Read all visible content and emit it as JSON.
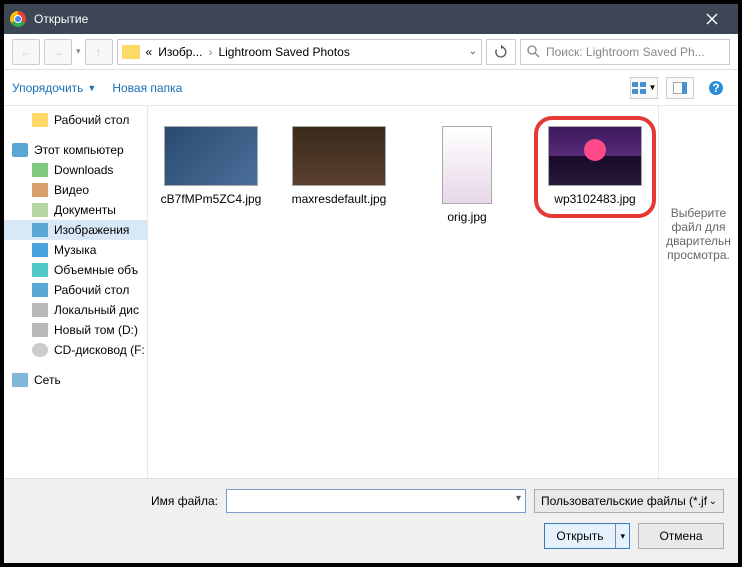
{
  "titlebar": {
    "title": "Открытие"
  },
  "breadcrumb": {
    "prev": "«",
    "p1": "Изобр...",
    "p2": "Lightroom Saved Photos"
  },
  "search": {
    "placeholder": "Поиск: Lightroom Saved Ph..."
  },
  "toolbar": {
    "organize": "Упорядочить",
    "newfolder": "Новая папка"
  },
  "tree": {
    "desktop": "Рабочий стол",
    "thispc": "Этот компьютер",
    "downloads": "Downloads",
    "video": "Видео",
    "documents": "Документы",
    "images": "Изображения",
    "music": "Музыка",
    "objects3d": "Объемные объ",
    "desktop2": "Рабочий стол",
    "localdisk": "Локальный дис",
    "newvol": "Новый том (D:)",
    "cddrive": "CD-дисковод (F:",
    "network": "Сеть"
  },
  "files": [
    {
      "name": "cB7fMPm5ZC4.jpg"
    },
    {
      "name": "maxresdefault.jpg"
    },
    {
      "name": "orig.jpg"
    },
    {
      "name": "wp3102483.jpg"
    }
  ],
  "preview": {
    "text": "Выберите файл для дварительн просмотра."
  },
  "footer": {
    "filename_label": "Имя файла:",
    "filename_value": "",
    "filetype": "Пользовательские файлы (*.jf",
    "open": "Открыть",
    "cancel": "Отмена"
  }
}
